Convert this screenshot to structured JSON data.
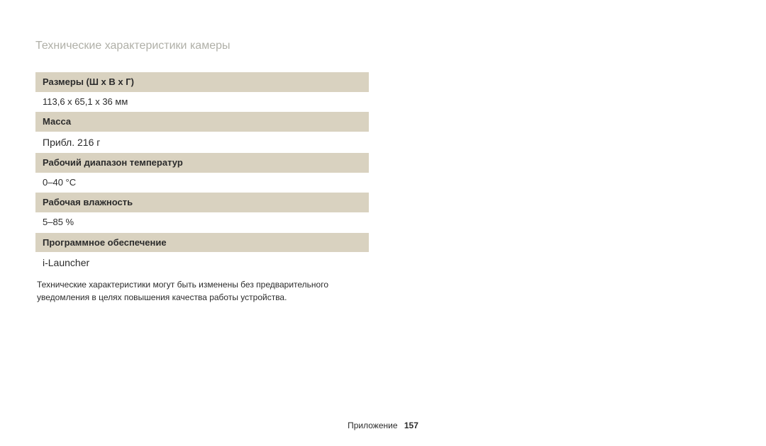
{
  "title": "Технические характеристики камеры",
  "specs": [
    {
      "label": "Размеры (Ш х В х Г)",
      "value": "113,6 x 65,1 x 36 мм",
      "valueLarger": false
    },
    {
      "label": "Масса",
      "value": "Прибл. 216 г",
      "valueLarger": true
    },
    {
      "label": "Рабочий диапазон температур",
      "value": "0–40 °C",
      "valueLarger": false
    },
    {
      "label": "Рабочая влажность",
      "value": "5–85 %",
      "valueLarger": false
    },
    {
      "label": "Программное обеспечение",
      "value": "i-Launcher",
      "valueLarger": true
    }
  ],
  "footnote": "Технические характеристики могут быть изменены без предварительного уведомления в целях повышения качества работы устройства.",
  "footer": {
    "section": "Приложение",
    "page": "157"
  }
}
